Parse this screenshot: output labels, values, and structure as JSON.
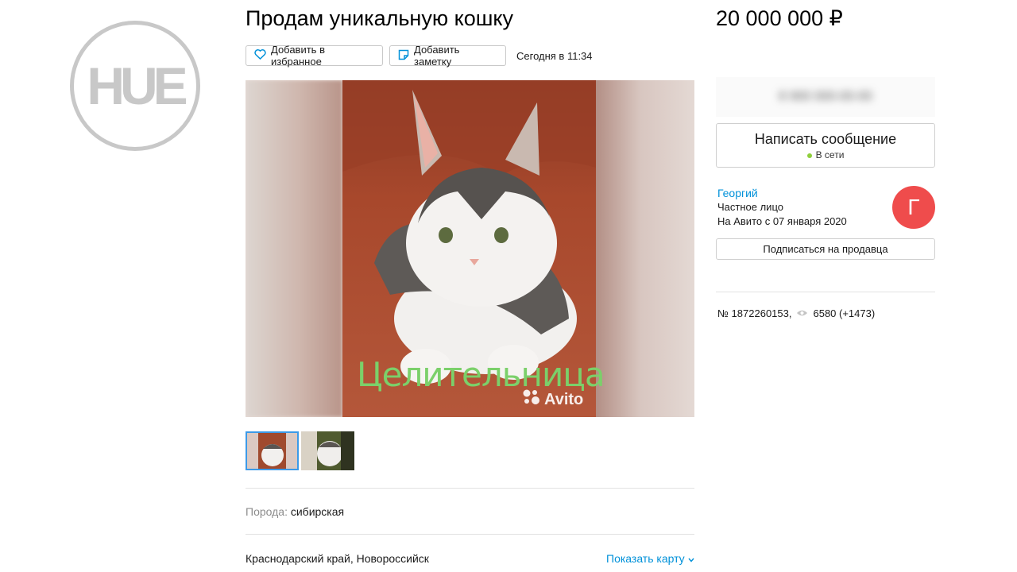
{
  "watermark": {
    "text": "HUE"
  },
  "listing": {
    "title": "Продам уникальную кошку",
    "price": "20 000 000 ₽",
    "favorite_label": "Добавить в избранное",
    "note_label": "Добавить заметку",
    "posted": "Сегодня в 11:34",
    "photo_caption": "Целительница",
    "photo_watermark": "Avito",
    "params": [
      {
        "key": "Порода:",
        "value": "сибирская"
      }
    ],
    "address": "Краснодарский край, Новороссийск",
    "show_map": "Показать карту"
  },
  "contact": {
    "phone_hidden": "8 900 000-00-00",
    "message_button": "Написать сообщение",
    "online_status": "В сети"
  },
  "seller": {
    "name": "Георгий",
    "type": "Частное лицо",
    "since": "На Авито с 07 января 2020",
    "avatar_letter": "Г",
    "subscribe": "Подписаться на продавца"
  },
  "ad_info": {
    "number": "№ 1872260153,",
    "views": "6580 (+1473)"
  },
  "colors": {
    "link": "#0091d9",
    "avatar": "#ef4c4c",
    "online": "#8fcf3c",
    "thumb_active": "#3c9ae8"
  },
  "icons": [
    "heart-icon",
    "note-icon",
    "eye-icon",
    "chevron-down-icon",
    "avito-logo-icon"
  ]
}
